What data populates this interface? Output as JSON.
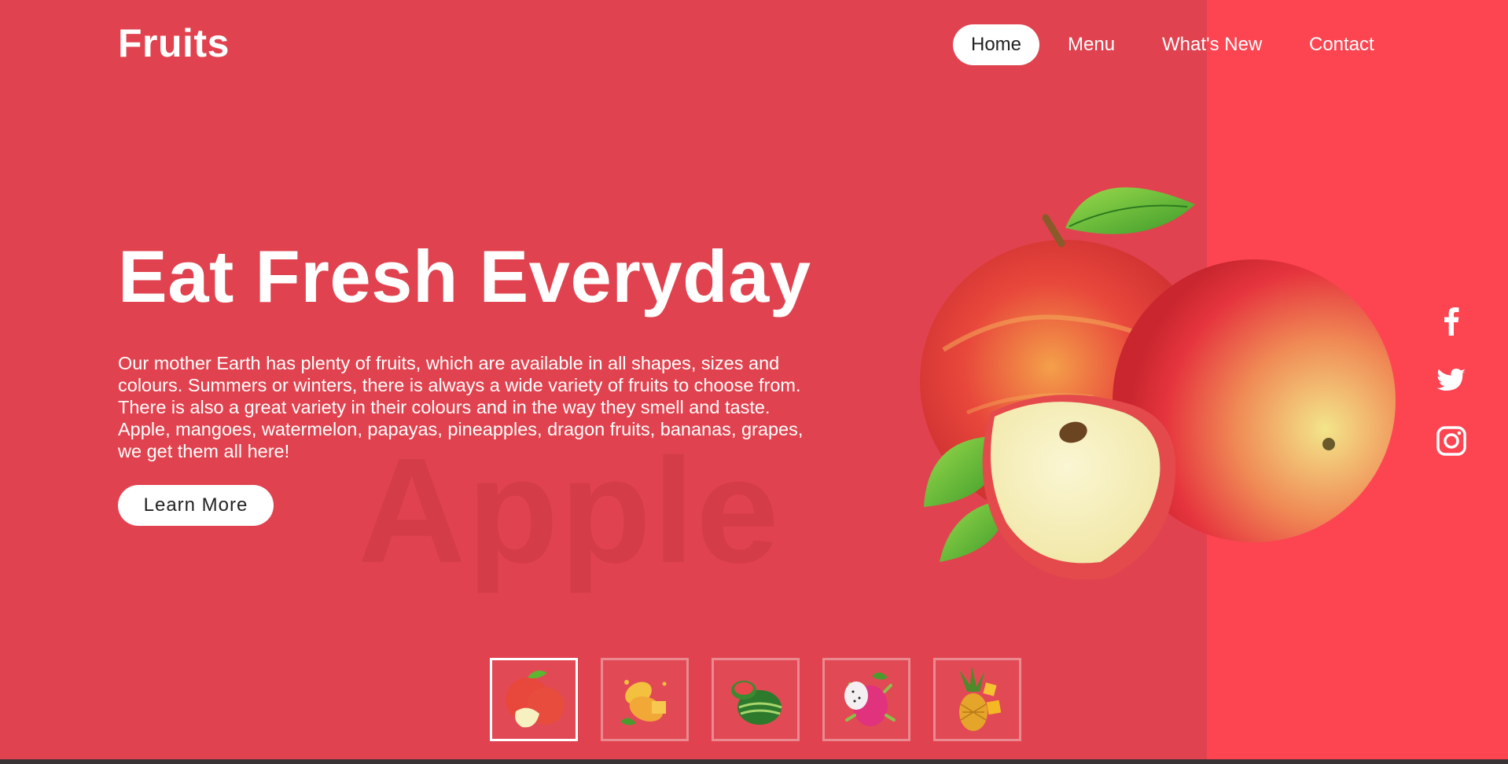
{
  "brand": {
    "logo": "Fruits"
  },
  "nav": {
    "items": [
      {
        "label": "Home",
        "active": true
      },
      {
        "label": "Menu",
        "active": false
      },
      {
        "label": "What's New",
        "active": false
      },
      {
        "label": "Contact",
        "active": false
      }
    ]
  },
  "hero": {
    "title": "Eat Fresh Everyday",
    "text_lines": [
      "Our mother Earth has plenty of fruits, which are available in all shapes, sizes and",
      "colours. Summers or winters, there is always a wide variety of fruits to choose from.",
      "There is also a great variety in their colours and in the way they smell and taste.",
      "Apple, mangoes, watermelon, papayas, pineapples, dragon fruits, bananas, grapes,",
      "we get them all here!"
    ],
    "button_label": "Learn More",
    "watermark": "Apple",
    "image_icon": "apple-image"
  },
  "social": [
    {
      "icon": "facebook-icon"
    },
    {
      "icon": "twitter-icon"
    },
    {
      "icon": "instagram-icon"
    }
  ],
  "thumbnails": [
    {
      "icon": "apple-thumb",
      "selected": true
    },
    {
      "icon": "mango-thumb",
      "selected": false
    },
    {
      "icon": "watermelon-thumb",
      "selected": false
    },
    {
      "icon": "dragon-fruit-thumb",
      "selected": false
    },
    {
      "icon": "pineapple-thumb",
      "selected": false
    }
  ],
  "colors": {
    "background": "#e0434f",
    "right_panel": "#fd4552",
    "watermark": "#d43c48",
    "text": "#ffffff"
  }
}
